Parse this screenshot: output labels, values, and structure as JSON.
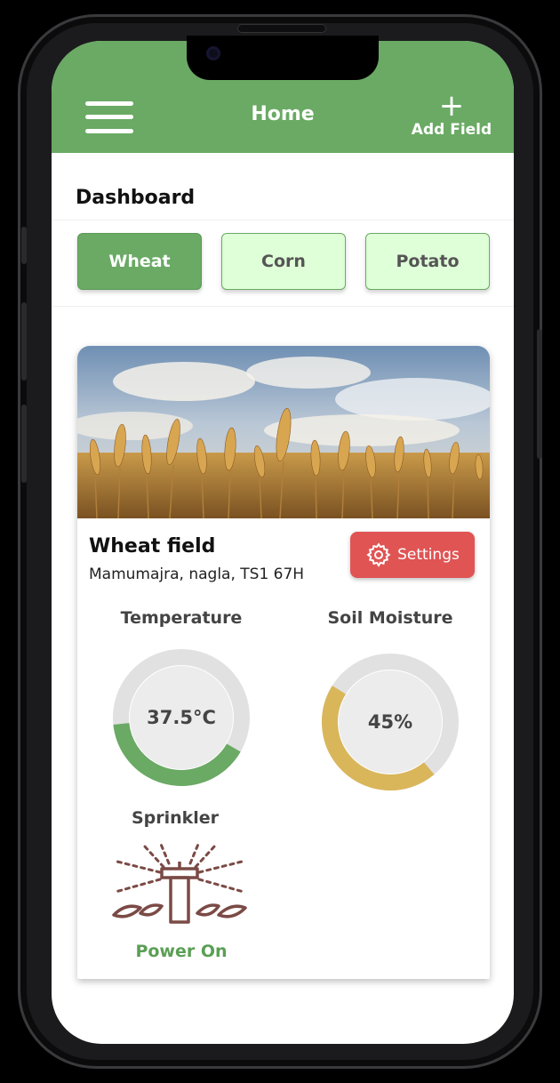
{
  "header": {
    "title": "Home",
    "add_field_label": "Add Field"
  },
  "dashboard": {
    "heading": "Dashboard",
    "crops": [
      {
        "label": "Wheat",
        "active": true
      },
      {
        "label": "Corn",
        "active": false
      },
      {
        "label": "Potato",
        "active": false
      }
    ]
  },
  "field": {
    "name": "Wheat field",
    "address": "Mamumajra, nagla, TS1 67H",
    "settings_label": "Settings"
  },
  "sensors": {
    "temperature": {
      "label": "Temperature",
      "value": "37.5°C",
      "fill_fraction": 0.4,
      "color": "#6aaa64"
    },
    "soil_moisture": {
      "label": "Soil Moisture",
      "value": "45%",
      "fill_fraction": 0.45,
      "color": "#d9b65a"
    },
    "sprinkler": {
      "label": "Sprinkler",
      "status": "Power On",
      "status_color": "#5b9f55"
    }
  },
  "colors": {
    "brand_green": "#6aaa64",
    "settings_red": "#e05454",
    "tab_inactive_bg": "#dfffd8"
  }
}
